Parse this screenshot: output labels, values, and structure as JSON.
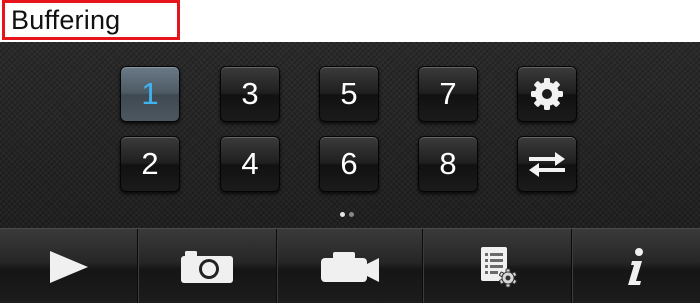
{
  "status": {
    "text": "Buffering"
  },
  "keypad": {
    "row1": [
      "1",
      "3",
      "5",
      "7"
    ],
    "row2": [
      "2",
      "4",
      "6",
      "8"
    ],
    "active_key": "1",
    "settings_icon": "gear-icon",
    "switch_icon": "swap-arrows-icon"
  },
  "pager": {
    "pages": 2,
    "current": 1
  },
  "toolbar": {
    "items": [
      {
        "icon": "play-icon"
      },
      {
        "icon": "camera-icon"
      },
      {
        "icon": "video-camera-icon"
      },
      {
        "icon": "settings-list-icon"
      },
      {
        "icon": "info-icon"
      }
    ]
  },
  "colors": {
    "status_border": "#e8141c",
    "active_digit": "#3fb4f0",
    "panel_bg": "#232323"
  }
}
